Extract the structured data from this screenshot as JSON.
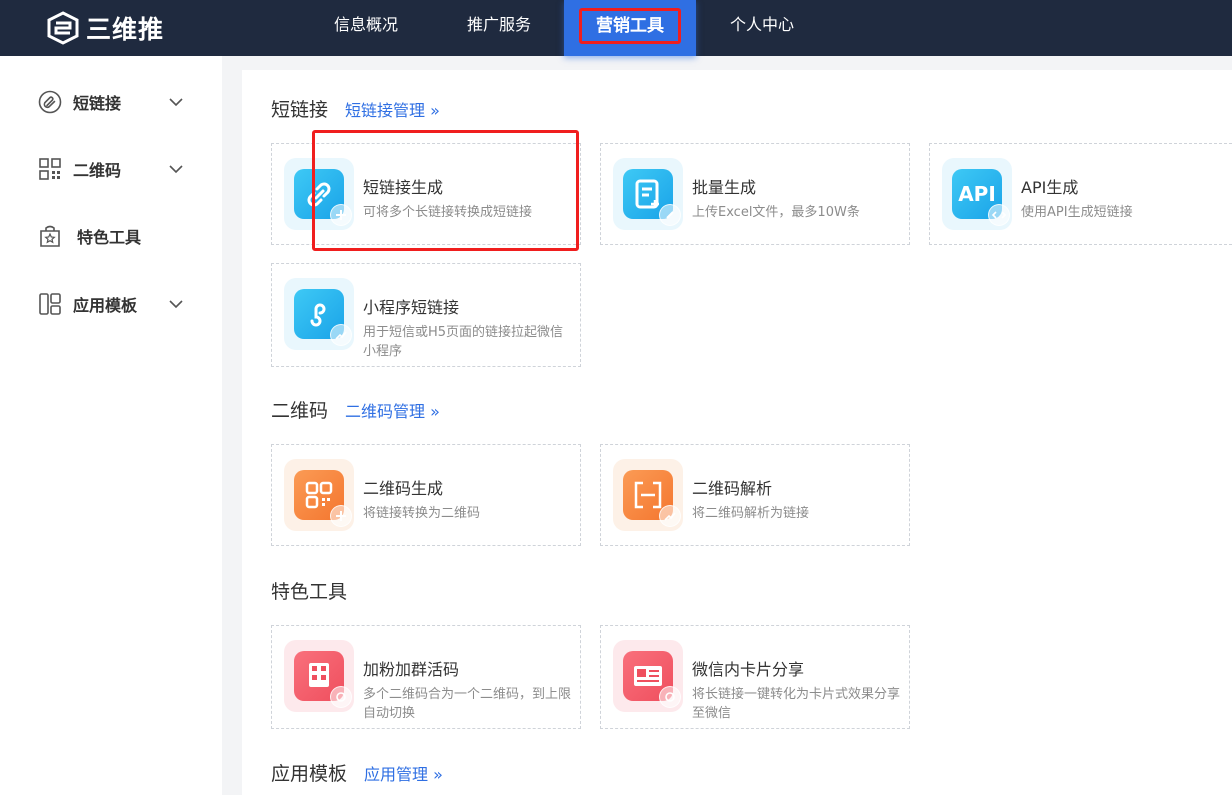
{
  "brand": {
    "name": "三维推"
  },
  "nav": {
    "items": [
      {
        "label": "信息概况"
      },
      {
        "label": "推广服务"
      },
      {
        "label": "营销工具"
      },
      {
        "label": "个人中心"
      }
    ]
  },
  "sidebar": {
    "items": [
      {
        "label": "短链接",
        "icon": "paperclip-icon"
      },
      {
        "label": "二维码",
        "icon": "qr-grid-icon"
      },
      {
        "label": "特色工具",
        "icon": "star-bag-icon"
      },
      {
        "label": "应用模板",
        "icon": "template-icon"
      }
    ]
  },
  "sections": {
    "shortlink": {
      "title": "短链接",
      "link": "短链接管理 »",
      "cards": [
        {
          "title": "短链接生成",
          "desc": "可将多个长链接转换成短链接",
          "icon": "link-icon"
        },
        {
          "title": "批量生成",
          "desc": "上传Excel文件，最多10W条",
          "icon": "document-icon"
        },
        {
          "title": "API生成",
          "desc": "使用API生成短链接",
          "icon": "api-icon",
          "icon_text": "API"
        },
        {
          "title": "小程序短链接",
          "desc": "用于短信或H5页面的链接拉起微信小程序",
          "icon": "miniprogram-icon"
        }
      ]
    },
    "qrcode": {
      "title": "二维码",
      "link": "二维码管理 »",
      "cards": [
        {
          "title": "二维码生成",
          "desc": "将链接转换为二维码",
          "icon": "qrcode-icon"
        },
        {
          "title": "二维码解析",
          "desc": "将二维码解析为链接",
          "icon": "scan-icon"
        }
      ]
    },
    "special": {
      "title": "特色工具",
      "cards": [
        {
          "title": "加粉加群活码",
          "desc": "多个二维码合为一个二维码，到上限自动切换",
          "icon": "live-qrcode-icon"
        },
        {
          "title": "微信内卡片分享",
          "desc": "将长链接一键转化为卡片式效果分享至微信",
          "icon": "card-share-icon"
        }
      ]
    },
    "templates": {
      "title": "应用模板",
      "link": "应用管理 »"
    }
  },
  "colors": {
    "topbar": "#1f2a3f",
    "accent": "#2f6fe3",
    "highlight": "#f01e1e"
  }
}
